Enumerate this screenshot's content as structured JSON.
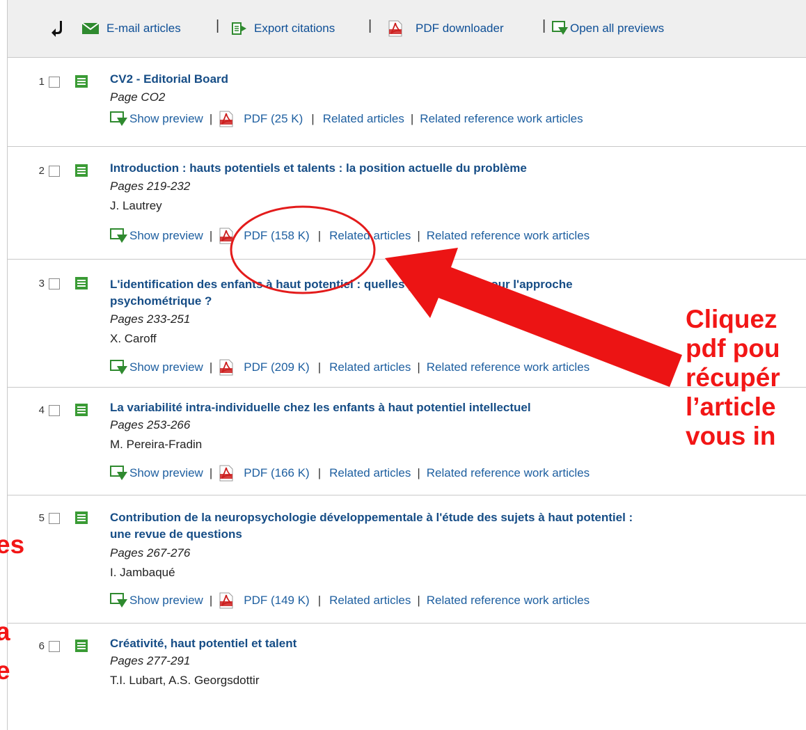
{
  "toolbar": {
    "email_label": "E-mail articles",
    "export_label": "Export citations",
    "pdf_downloader_label": "PDF downloader",
    "open_previews_label": "Open all previews"
  },
  "articles": [
    {
      "number": "1",
      "title_lines": [
        "CV2 - Editorial Board"
      ],
      "pages": "Page CO2",
      "authors": "",
      "show_preview": "Show preview",
      "pdf": "PDF (25 K)",
      "related": "Related articles",
      "related_ref": "Related reference work articles"
    },
    {
      "number": "2",
      "title_lines": [
        "Introduction : hauts potentiels et talents : la position actuelle du problème"
      ],
      "pages": "Pages 219-232",
      "authors": "J. Lautrey",
      "show_preview": "Show preview",
      "pdf": "PDF (158 K)",
      "related": "Related articles",
      "related_ref": "Related reference work articles"
    },
    {
      "number": "3",
      "title_lines": [
        "L'identification des enfants à haut potentiel : quelles perspectives pour l'approche",
        "psychométrique ?"
      ],
      "pages": "Pages 233-251",
      "authors": "X. Caroff",
      "show_preview": "Show preview",
      "pdf": "PDF (209 K)",
      "related": "Related articles",
      "related_ref": "Related reference work articles"
    },
    {
      "number": "4",
      "title_lines": [
        "La variabilité intra-individuelle chez les enfants à haut potentiel intellectuel"
      ],
      "pages": "Pages 253-266",
      "authors": "M. Pereira-Fradin",
      "show_preview": "Show preview",
      "pdf": "PDF (166 K)",
      "related": "Related articles",
      "related_ref": "Related reference work articles"
    },
    {
      "number": "5",
      "title_lines": [
        "Contribution de la neuropsychologie développementale à l'étude des sujets à haut potentiel :",
        "une revue de questions"
      ],
      "pages": "Pages 267-276",
      "authors": "I. Jambaqué",
      "show_preview": "Show preview",
      "pdf": "PDF (149 K)",
      "related": "Related articles",
      "related_ref": "Related reference work articles"
    },
    {
      "number": "6",
      "title_lines": [
        "Créativité, haut potentiel et talent"
      ],
      "pages": "Pages 277-291",
      "authors": "T.I. Lubart, A.S. Georgsdottir",
      "show_preview": "",
      "pdf": "",
      "related": "",
      "related_ref": ""
    }
  ],
  "annotation": {
    "callout_lines": [
      "Cliquez",
      "pdf pou",
      "récupér",
      "l’article",
      "vous in"
    ],
    "left_fragments": [
      "es",
      "a",
      "e"
    ],
    "color": "#f21616"
  },
  "colors": {
    "link": "#1e5fa0",
    "title": "#164d86",
    "toolbar_bg": "#efefef",
    "doc_icon": "#3a9b35",
    "pdf_icon": "#cc1e1e"
  }
}
